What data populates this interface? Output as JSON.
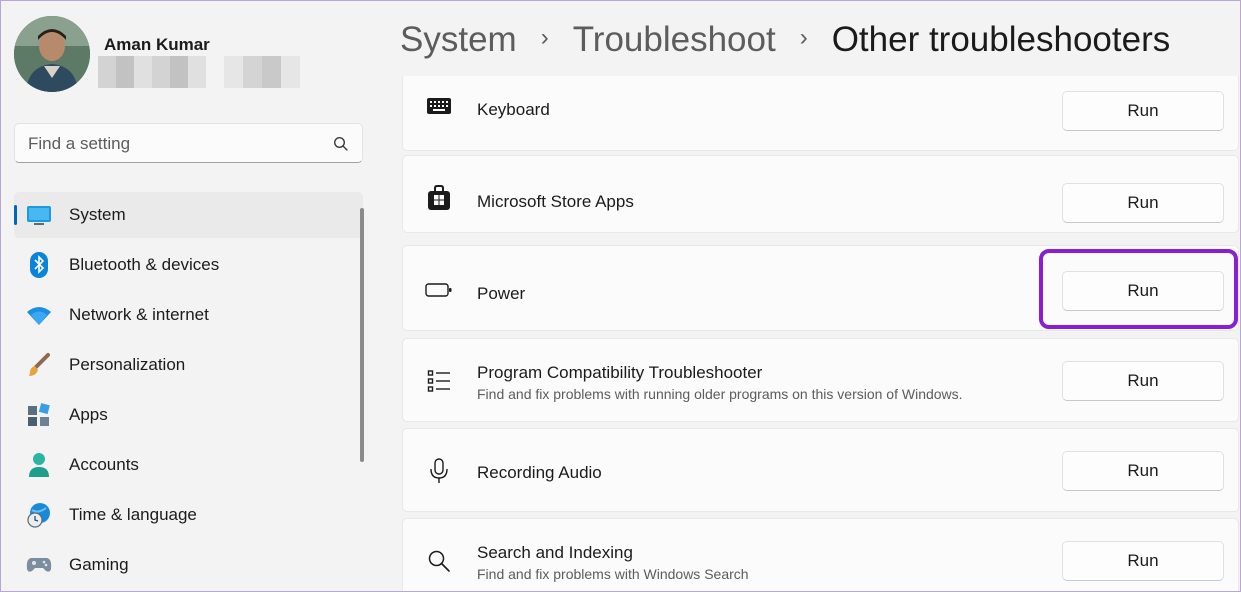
{
  "user": {
    "name": "Aman Kumar"
  },
  "search": {
    "placeholder": "Find a setting",
    "icon": "search-icon"
  },
  "sidebar": {
    "items": [
      {
        "label": "System",
        "icon": "system-monitor-icon",
        "active": true
      },
      {
        "label": "Bluetooth & devices",
        "icon": "bluetooth-icon"
      },
      {
        "label": "Network & internet",
        "icon": "wifi-icon"
      },
      {
        "label": "Personalization",
        "icon": "paintbrush-icon"
      },
      {
        "label": "Apps",
        "icon": "apps-icon"
      },
      {
        "label": "Accounts",
        "icon": "person-icon"
      },
      {
        "label": "Time & language",
        "icon": "globe-clock-icon"
      },
      {
        "label": "Gaming",
        "icon": "gamepad-icon"
      }
    ]
  },
  "breadcrumb": {
    "items": [
      "System",
      "Troubleshoot",
      "Other troubleshooters"
    ]
  },
  "troubleshooters": [
    {
      "title": "Keyboard",
      "description": "",
      "icon": "keyboard-icon",
      "button": "Run"
    },
    {
      "title": "Microsoft Store Apps",
      "description": "",
      "icon": "store-bag-icon",
      "button": "Run"
    },
    {
      "title": "Power",
      "description": "",
      "icon": "battery-icon",
      "button": "Run",
      "highlighted": true
    },
    {
      "title": "Program Compatibility Troubleshooter",
      "description": "Find and fix problems with running older programs on this version of Windows.",
      "icon": "list-icon",
      "button": "Run"
    },
    {
      "title": "Recording Audio",
      "description": "",
      "icon": "microphone-icon",
      "button": "Run"
    },
    {
      "title": "Search and Indexing",
      "description": "Find and fix problems with Windows Search",
      "icon": "search-icon",
      "button": "Run"
    }
  ],
  "colors": {
    "accent": "#0067c0",
    "highlight": "#8a1fd1"
  }
}
